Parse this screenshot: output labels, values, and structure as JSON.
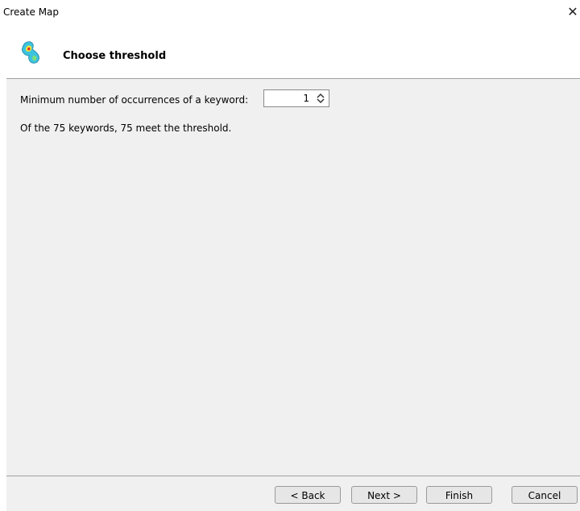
{
  "window": {
    "title": "Create Map",
    "close_glyph": "✕"
  },
  "header": {
    "title": "Choose threshold",
    "icon": "vosviewer-map-icon"
  },
  "threshold": {
    "label": "Minimum number of occurrences of a keyword:",
    "value": "1"
  },
  "summary": "Of the 75 keywords, 75 meet the threshold.",
  "buttons": {
    "back": "< Back",
    "next": "Next >",
    "finish": "Finish",
    "cancel": "Cancel"
  }
}
